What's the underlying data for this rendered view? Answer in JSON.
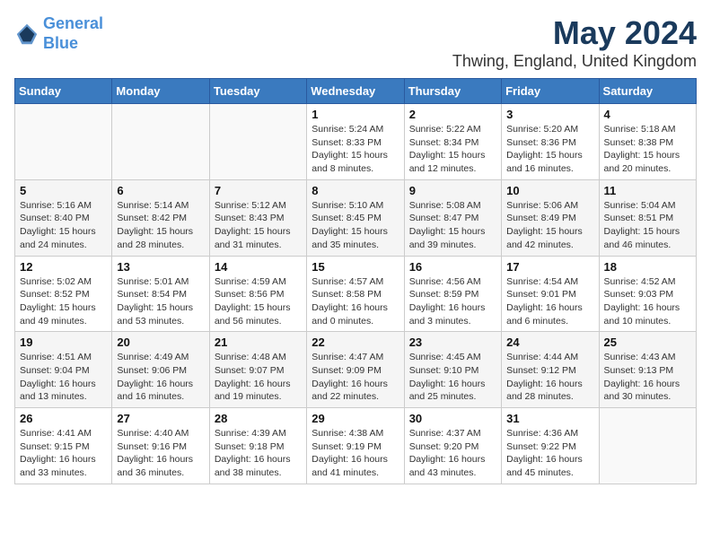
{
  "header": {
    "logo_line1": "General",
    "logo_line2": "Blue",
    "month_year": "May 2024",
    "location": "Thwing, England, United Kingdom"
  },
  "weekdays": [
    "Sunday",
    "Monday",
    "Tuesday",
    "Wednesday",
    "Thursday",
    "Friday",
    "Saturday"
  ],
  "weeks": [
    [
      {
        "day": "",
        "info": ""
      },
      {
        "day": "",
        "info": ""
      },
      {
        "day": "",
        "info": ""
      },
      {
        "day": "1",
        "info": "Sunrise: 5:24 AM\nSunset: 8:33 PM\nDaylight: 15 hours\nand 8 minutes."
      },
      {
        "day": "2",
        "info": "Sunrise: 5:22 AM\nSunset: 8:34 PM\nDaylight: 15 hours\nand 12 minutes."
      },
      {
        "day": "3",
        "info": "Sunrise: 5:20 AM\nSunset: 8:36 PM\nDaylight: 15 hours\nand 16 minutes."
      },
      {
        "day": "4",
        "info": "Sunrise: 5:18 AM\nSunset: 8:38 PM\nDaylight: 15 hours\nand 20 minutes."
      }
    ],
    [
      {
        "day": "5",
        "info": "Sunrise: 5:16 AM\nSunset: 8:40 PM\nDaylight: 15 hours\nand 24 minutes."
      },
      {
        "day": "6",
        "info": "Sunrise: 5:14 AM\nSunset: 8:42 PM\nDaylight: 15 hours\nand 28 minutes."
      },
      {
        "day": "7",
        "info": "Sunrise: 5:12 AM\nSunset: 8:43 PM\nDaylight: 15 hours\nand 31 minutes."
      },
      {
        "day": "8",
        "info": "Sunrise: 5:10 AM\nSunset: 8:45 PM\nDaylight: 15 hours\nand 35 minutes."
      },
      {
        "day": "9",
        "info": "Sunrise: 5:08 AM\nSunset: 8:47 PM\nDaylight: 15 hours\nand 39 minutes."
      },
      {
        "day": "10",
        "info": "Sunrise: 5:06 AM\nSunset: 8:49 PM\nDaylight: 15 hours\nand 42 minutes."
      },
      {
        "day": "11",
        "info": "Sunrise: 5:04 AM\nSunset: 8:51 PM\nDaylight: 15 hours\nand 46 minutes."
      }
    ],
    [
      {
        "day": "12",
        "info": "Sunrise: 5:02 AM\nSunset: 8:52 PM\nDaylight: 15 hours\nand 49 minutes."
      },
      {
        "day": "13",
        "info": "Sunrise: 5:01 AM\nSunset: 8:54 PM\nDaylight: 15 hours\nand 53 minutes."
      },
      {
        "day": "14",
        "info": "Sunrise: 4:59 AM\nSunset: 8:56 PM\nDaylight: 15 hours\nand 56 minutes."
      },
      {
        "day": "15",
        "info": "Sunrise: 4:57 AM\nSunset: 8:58 PM\nDaylight: 16 hours\nand 0 minutes."
      },
      {
        "day": "16",
        "info": "Sunrise: 4:56 AM\nSunset: 8:59 PM\nDaylight: 16 hours\nand 3 minutes."
      },
      {
        "day": "17",
        "info": "Sunrise: 4:54 AM\nSunset: 9:01 PM\nDaylight: 16 hours\nand 6 minutes."
      },
      {
        "day": "18",
        "info": "Sunrise: 4:52 AM\nSunset: 9:03 PM\nDaylight: 16 hours\nand 10 minutes."
      }
    ],
    [
      {
        "day": "19",
        "info": "Sunrise: 4:51 AM\nSunset: 9:04 PM\nDaylight: 16 hours\nand 13 minutes."
      },
      {
        "day": "20",
        "info": "Sunrise: 4:49 AM\nSunset: 9:06 PM\nDaylight: 16 hours\nand 16 minutes."
      },
      {
        "day": "21",
        "info": "Sunrise: 4:48 AM\nSunset: 9:07 PM\nDaylight: 16 hours\nand 19 minutes."
      },
      {
        "day": "22",
        "info": "Sunrise: 4:47 AM\nSunset: 9:09 PM\nDaylight: 16 hours\nand 22 minutes."
      },
      {
        "day": "23",
        "info": "Sunrise: 4:45 AM\nSunset: 9:10 PM\nDaylight: 16 hours\nand 25 minutes."
      },
      {
        "day": "24",
        "info": "Sunrise: 4:44 AM\nSunset: 9:12 PM\nDaylight: 16 hours\nand 28 minutes."
      },
      {
        "day": "25",
        "info": "Sunrise: 4:43 AM\nSunset: 9:13 PM\nDaylight: 16 hours\nand 30 minutes."
      }
    ],
    [
      {
        "day": "26",
        "info": "Sunrise: 4:41 AM\nSunset: 9:15 PM\nDaylight: 16 hours\nand 33 minutes."
      },
      {
        "day": "27",
        "info": "Sunrise: 4:40 AM\nSunset: 9:16 PM\nDaylight: 16 hours\nand 36 minutes."
      },
      {
        "day": "28",
        "info": "Sunrise: 4:39 AM\nSunset: 9:18 PM\nDaylight: 16 hours\nand 38 minutes."
      },
      {
        "day": "29",
        "info": "Sunrise: 4:38 AM\nSunset: 9:19 PM\nDaylight: 16 hours\nand 41 minutes."
      },
      {
        "day": "30",
        "info": "Sunrise: 4:37 AM\nSunset: 9:20 PM\nDaylight: 16 hours\nand 43 minutes."
      },
      {
        "day": "31",
        "info": "Sunrise: 4:36 AM\nSunset: 9:22 PM\nDaylight: 16 hours\nand 45 minutes."
      },
      {
        "day": "",
        "info": ""
      }
    ]
  ]
}
